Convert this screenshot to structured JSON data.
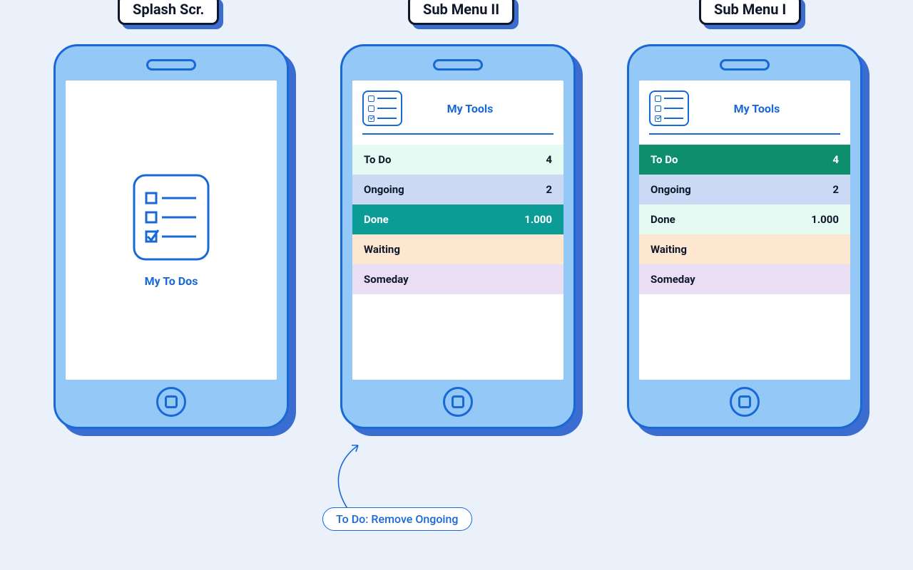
{
  "labels": {
    "splash": "Splash Scr.",
    "submenu2": "Sub Menu II",
    "submenu1": "Sub Menu I"
  },
  "splash": {
    "app_name": "My To Dos"
  },
  "tools_header": "My Tools",
  "phone2": {
    "rows": [
      {
        "label": "To Do",
        "count": "4",
        "bg": "#e6faf4",
        "fg": "#0f172a"
      },
      {
        "label": "Ongoing",
        "count": "2",
        "bg": "#ccd9f4",
        "fg": "#0f172a"
      },
      {
        "label": "Done",
        "count": "1.000",
        "bg": "#0b9c96",
        "fg": "#ffffff"
      },
      {
        "label": "Waiting",
        "count": "",
        "bg": "#fde7d0",
        "fg": "#0f172a"
      },
      {
        "label": "Someday",
        "count": "",
        "bg": "#eadef5",
        "fg": "#0f172a"
      }
    ]
  },
  "phone3": {
    "rows": [
      {
        "label": "To Do",
        "count": "4",
        "bg": "#0d8f6e",
        "fg": "#ffffff"
      },
      {
        "label": "Ongoing",
        "count": "2",
        "bg": "#ccd9f4",
        "fg": "#0f172a"
      },
      {
        "label": "Done",
        "count": "1.000",
        "bg": "#e6faf4",
        "fg": "#0f172a"
      },
      {
        "label": "Waiting",
        "count": "",
        "bg": "#fde7d0",
        "fg": "#0f172a"
      },
      {
        "label": "Someday",
        "count": "",
        "bg": "#eadef5",
        "fg": "#0f172a"
      }
    ]
  },
  "annotation": "To Do: Remove Ongoing"
}
